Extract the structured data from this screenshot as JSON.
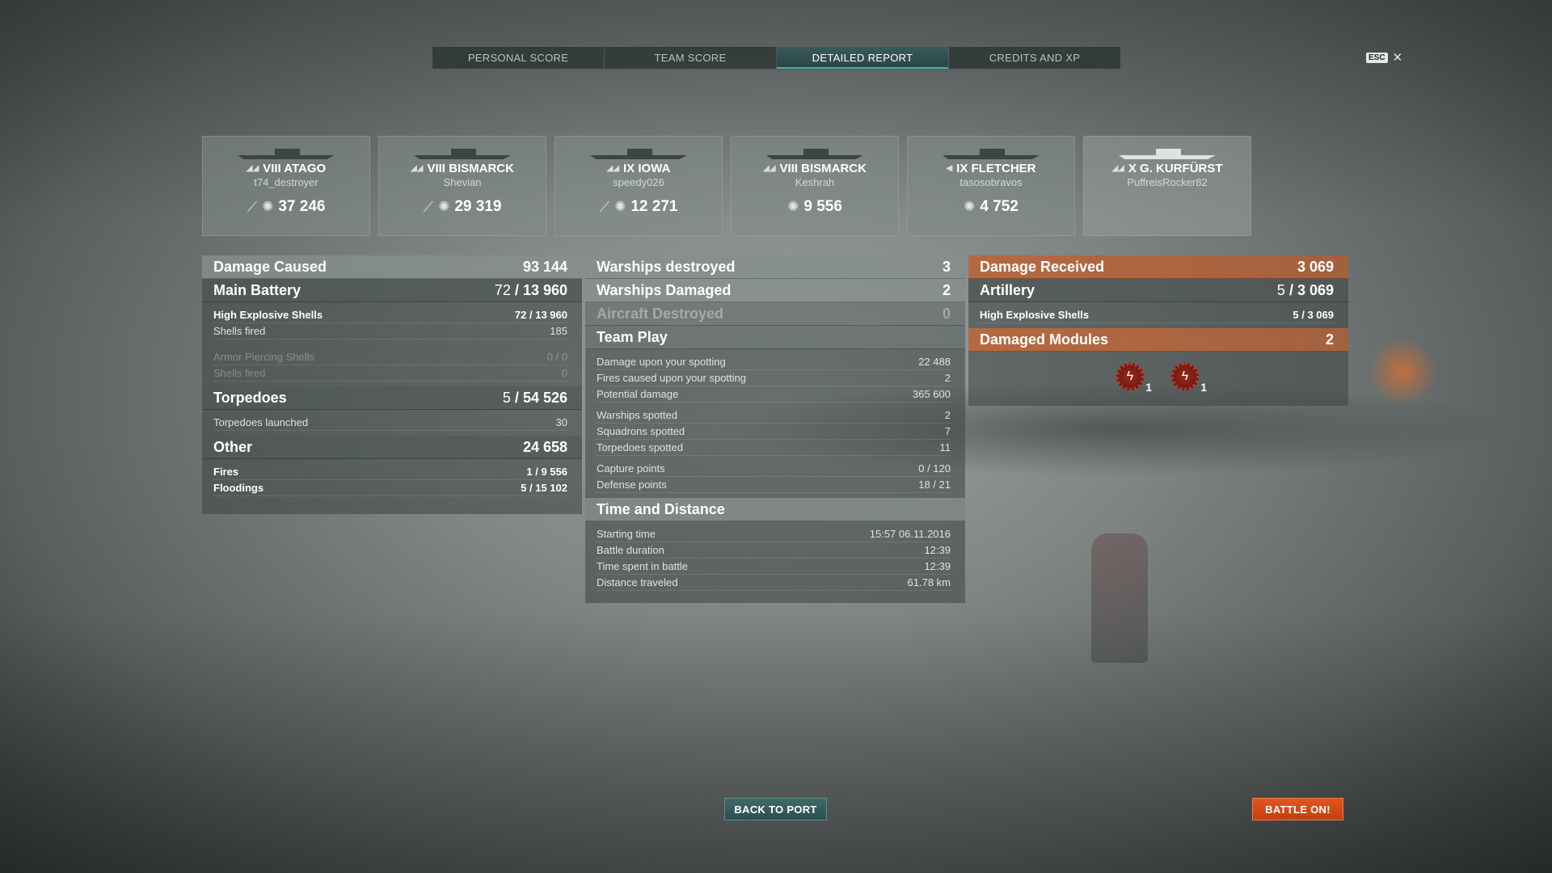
{
  "tabs": [
    {
      "label": "PERSONAL SCORE"
    },
    {
      "label": "TEAM SCORE"
    },
    {
      "label": "DETAILED REPORT"
    },
    {
      "label": "CREDITS AND XP"
    }
  ],
  "esc": {
    "key": "ESC",
    "close": "✕"
  },
  "ships": [
    {
      "name": "VIII ATAGO",
      "player": "t74_destroyer",
      "damage": "37 246"
    },
    {
      "name": "VIII BISMARCK",
      "player": "Shevian",
      "damage": "29 319"
    },
    {
      "name": "IX IOWA",
      "player": "speedy026",
      "damage": "12 271"
    },
    {
      "name": "VIII BISMARCK",
      "player": "Keshrah",
      "damage": "9 556"
    },
    {
      "name": "IX FLETCHER",
      "player": "tasosobravos",
      "damage": "4 752"
    },
    {
      "name": "X G. KURFÜRST",
      "player": "PuffreisRocker82"
    }
  ],
  "damage_caused": {
    "label": "Damage Caused",
    "value": "93 144",
    "main_battery": {
      "label": "Main Battery",
      "hits": "72",
      "value": "13 960"
    },
    "he": {
      "label": "High Explosive Shells",
      "hits": "72",
      "value": "13 960",
      "fired_label": "Shells fired",
      "fired": "185"
    },
    "ap": {
      "label": "Armor Piercing Shells",
      "value": "0 / 0",
      "fired_label": "Shells fired",
      "fired": "0"
    },
    "torpedoes": {
      "label": "Torpedoes",
      "hits": "5",
      "value": "54 526",
      "launched_label": "Torpedoes launched",
      "launched": "30"
    },
    "other": {
      "label": "Other",
      "value": "24 658",
      "fires": {
        "label": "Fires",
        "hits": "1",
        "value": "9 556"
      },
      "floodings": {
        "label": "Floodings",
        "hits": "5",
        "value": "15 102"
      }
    }
  },
  "middle": {
    "destroyed": {
      "label": "Warships destroyed",
      "value": "3"
    },
    "damaged": {
      "label": "Warships Damaged",
      "value": "2"
    },
    "aircraft": {
      "label": "Aircraft Destroyed",
      "value": "0"
    },
    "team_play": {
      "label": "Team Play",
      "rows1": [
        {
          "label": "Damage upon your spotting",
          "value": "22 488"
        },
        {
          "label": "Fires caused upon your spotting",
          "value": "2"
        },
        {
          "label": "Potential damage",
          "value": "365 600"
        }
      ],
      "rows2": [
        {
          "label": "Warships spotted",
          "value": "2"
        },
        {
          "label": "Squadrons spotted",
          "value": "7"
        },
        {
          "label": "Torpedoes spotted",
          "value": "11"
        }
      ],
      "rows3": [
        {
          "label": "Capture points",
          "value": "0 / 120"
        },
        {
          "label": "Defense points",
          "value": "18 / 21"
        }
      ]
    },
    "time": {
      "label": "Time and Distance",
      "rows": [
        {
          "label": "Starting time",
          "value": "15:57  06.11.2016"
        },
        {
          "label": "Battle duration",
          "value": "12:39"
        },
        {
          "label": "Time spent in battle",
          "value": "12:39"
        },
        {
          "label": "Distance traveled",
          "value": "61.78 km"
        }
      ]
    }
  },
  "received": {
    "label": "Damage Received",
    "value": "3 069",
    "artillery": {
      "label": "Artillery",
      "hits": "5",
      "value": "3 069"
    },
    "he": {
      "label": "High Explosive Shells",
      "hits": "5",
      "value": "3 069"
    },
    "modules": {
      "label": "Damaged Modules",
      "value": "2",
      "items": [
        {
          "count": "1"
        },
        {
          "count": "1"
        }
      ]
    }
  },
  "buttons": {
    "back": "BACK TO PORT",
    "battle": "BATTLE ON!"
  },
  "colors": {
    "accent_teal": "#3fb1a8",
    "received_orange": "#c46a3a",
    "battle_button": "#e5541d"
  }
}
